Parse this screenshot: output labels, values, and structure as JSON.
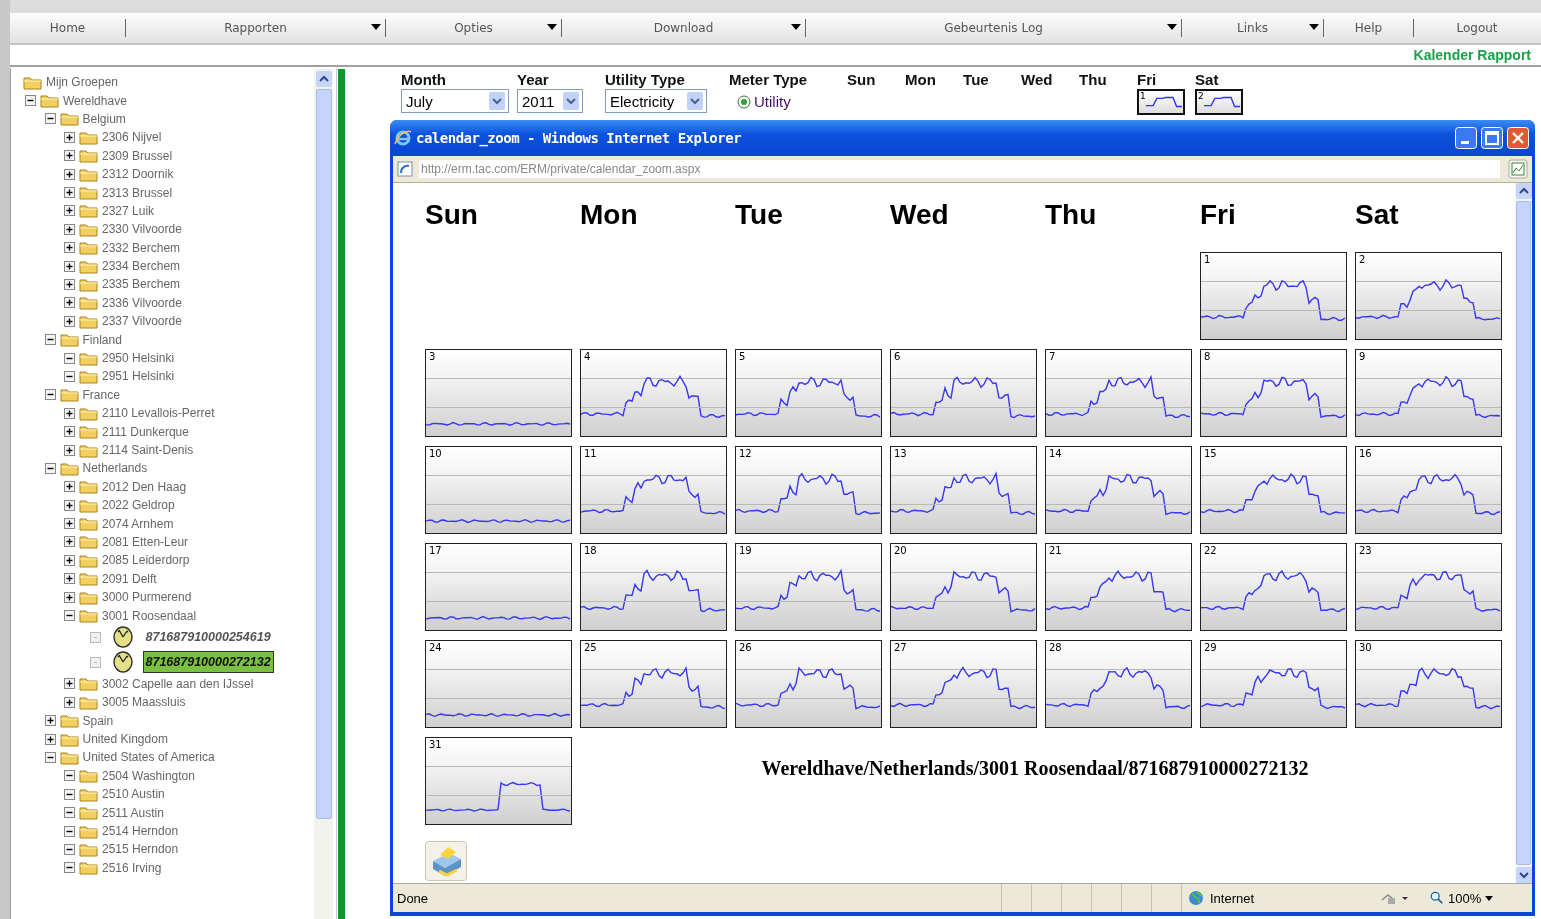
{
  "menu": [
    {
      "label": "Home",
      "has_menu": false
    },
    {
      "label": "Rapporten",
      "has_menu": true
    },
    {
      "label": "Opties",
      "has_menu": true
    },
    {
      "label": "Download",
      "has_menu": true
    },
    {
      "label": "Gebeurtenis Log",
      "has_menu": true
    },
    {
      "label": "Links",
      "has_menu": true
    },
    {
      "label": "Help",
      "has_menu": false
    },
    {
      "label": "Logout",
      "has_menu": false
    }
  ],
  "page_title": "Kalender Rapport",
  "tree": [
    {
      "label": "Mijn Groepen",
      "kind": "root",
      "children": [
        {
          "label": "Wereldhave",
          "kind": "folder",
          "expanded": true,
          "children": [
            {
              "label": "Belgium",
              "kind": "folder",
              "expanded": true,
              "children": [
                {
                  "label": "2306 Nijvel",
                  "kind": "folder",
                  "expanded": false
                },
                {
                  "label": "2309 Brussel",
                  "kind": "folder",
                  "expanded": false
                },
                {
                  "label": "2312 Doornik",
                  "kind": "folder",
                  "expanded": false
                },
                {
                  "label": "2313 Brussel",
                  "kind": "folder",
                  "expanded": false
                },
                {
                  "label": "2327 Luik",
                  "kind": "folder",
                  "expanded": false
                },
                {
                  "label": "2330 Vilvoorde",
                  "kind": "folder",
                  "expanded": false
                },
                {
                  "label": "2332 Berchem",
                  "kind": "folder",
                  "expanded": false
                },
                {
                  "label": "2334 Berchem",
                  "kind": "folder",
                  "expanded": false
                },
                {
                  "label": "2335 Berchem",
                  "kind": "folder",
                  "expanded": false
                },
                {
                  "label": "2336 Vilvoorde",
                  "kind": "folder",
                  "expanded": false
                },
                {
                  "label": "2337 Vilvoorde",
                  "kind": "folder",
                  "expanded": false
                }
              ]
            },
            {
              "label": "Finland",
              "kind": "folder",
              "expanded": true,
              "children": [
                {
                  "label": "2950 Helsinki",
                  "kind": "folder",
                  "expanded": true
                },
                {
                  "label": "2951 Helsinki",
                  "kind": "folder",
                  "expanded": true
                }
              ]
            },
            {
              "label": "France",
              "kind": "folder",
              "expanded": true,
              "children": [
                {
                  "label": "2110 Levallois-Perret",
                  "kind": "folder",
                  "expanded": false
                },
                {
                  "label": "2111 Dunkerque",
                  "kind": "folder",
                  "expanded": false
                },
                {
                  "label": "2114 Saint-Denis",
                  "kind": "folder",
                  "expanded": false
                }
              ]
            },
            {
              "label": "Netherlands",
              "kind": "folder",
              "expanded": true,
              "children": [
                {
                  "label": "2012 Den Haag",
                  "kind": "folder",
                  "expanded": false
                },
                {
                  "label": "2022 Geldrop",
                  "kind": "folder",
                  "expanded": false
                },
                {
                  "label": "2074 Arnhem",
                  "kind": "folder",
                  "expanded": false
                },
                {
                  "label": "2081 Etten-Leur",
                  "kind": "folder",
                  "expanded": false
                },
                {
                  "label": "2085 Leiderdorp",
                  "kind": "folder",
                  "expanded": false
                },
                {
                  "label": "2091 Delft",
                  "kind": "folder",
                  "expanded": false
                },
                {
                  "label": "3000 Purmerend",
                  "kind": "folder",
                  "expanded": false
                },
                {
                  "label": "3001 Roosendaal",
                  "kind": "folder",
                  "expanded": true,
                  "children": [
                    {
                      "label": "871687910000254619",
                      "kind": "meter",
                      "selected": false
                    },
                    {
                      "label": "871687910000272132",
                      "kind": "meter",
                      "selected": true
                    }
                  ]
                },
                {
                  "label": "3002 Capelle aan den IJssel",
                  "kind": "folder",
                  "expanded": false
                },
                {
                  "label": "3005 Maassluis",
                  "kind": "folder",
                  "expanded": false
                }
              ]
            },
            {
              "label": "Spain",
              "kind": "folder",
              "expanded": false
            },
            {
              "label": "United Kingdom",
              "kind": "folder",
              "expanded": false
            },
            {
              "label": "United States of America",
              "kind": "folder",
              "expanded": true,
              "children": [
                {
                  "label": "2504 Washington",
                  "kind": "folder",
                  "expanded": true
                },
                {
                  "label": "2510 Austin",
                  "kind": "folder",
                  "expanded": true
                },
                {
                  "label": "2511 Austin",
                  "kind": "folder",
                  "expanded": true
                },
                {
                  "label": "2514 Herndon",
                  "kind": "folder",
                  "expanded": true
                },
                {
                  "label": "2515 Herndon",
                  "kind": "folder",
                  "expanded": true
                },
                {
                  "label": "2516 Irving",
                  "kind": "folder",
                  "expanded": true
                }
              ]
            }
          ]
        }
      ]
    }
  ],
  "filters": {
    "month": {
      "label": "Month",
      "value": "July"
    },
    "year": {
      "label": "Year",
      "value": "2011"
    },
    "utility": {
      "label": "Utility Type",
      "value": "Electricity"
    },
    "meter_type": {
      "label": "Meter Type",
      "option": "Utility",
      "selected": true
    }
  },
  "week_header": [
    {
      "day": "Sun"
    },
    {
      "day": "Mon"
    },
    {
      "day": "Tue"
    },
    {
      "day": "Wed"
    },
    {
      "day": "Thu"
    },
    {
      "day": "Fri",
      "thumb": "1"
    },
    {
      "day": "Sat",
      "thumb": "2"
    }
  ],
  "popup": {
    "title": "calendar_zoom - Windows Internet Explorer",
    "url": "http://erm.tac.com/ERM/private/calendar_zoom.aspx",
    "weekdays": [
      "Sun",
      "Mon",
      "Tue",
      "Wed",
      "Thu",
      "Fri",
      "Sat"
    ],
    "weeks": [
      [
        {
          "day": "1",
          "kind": "weekday"
        },
        {
          "day": "2",
          "kind": "weekday"
        }
      ],
      [
        {
          "day": "3",
          "kind": "flat"
        },
        {
          "day": "4",
          "kind": "weekday"
        },
        {
          "day": "5",
          "kind": "weekday"
        },
        {
          "day": "6",
          "kind": "weekday"
        },
        {
          "day": "7",
          "kind": "weekday"
        },
        {
          "day": "8",
          "kind": "weekday"
        },
        {
          "day": "9",
          "kind": "weekday"
        }
      ],
      [
        {
          "day": "10",
          "kind": "flat"
        },
        {
          "day": "11",
          "kind": "weekday"
        },
        {
          "day": "12",
          "kind": "weekday"
        },
        {
          "day": "13",
          "kind": "weekday"
        },
        {
          "day": "14",
          "kind": "weekday"
        },
        {
          "day": "15",
          "kind": "weekday"
        },
        {
          "day": "16",
          "kind": "weekday"
        }
      ],
      [
        {
          "day": "17",
          "kind": "flat"
        },
        {
          "day": "18",
          "kind": "weekday"
        },
        {
          "day": "19",
          "kind": "weekday"
        },
        {
          "day": "20",
          "kind": "weekday"
        },
        {
          "day": "21",
          "kind": "weekday"
        },
        {
          "day": "22",
          "kind": "weekday"
        },
        {
          "day": "23",
          "kind": "weekday"
        }
      ],
      [
        {
          "day": "24",
          "kind": "flat"
        },
        {
          "day": "25",
          "kind": "weekday"
        },
        {
          "day": "26",
          "kind": "weekday"
        },
        {
          "day": "27",
          "kind": "weekday"
        },
        {
          "day": "28",
          "kind": "weekday"
        },
        {
          "day": "29",
          "kind": "weekday"
        },
        {
          "day": "30",
          "kind": "weekday"
        }
      ],
      [
        {
          "day": "31",
          "kind": "partial"
        }
      ]
    ],
    "caption": "Wereldhave/Netherlands/3001 Roosendaal/871687910000272132",
    "status": "Done",
    "zone": "Internet",
    "zoom": "100%"
  }
}
